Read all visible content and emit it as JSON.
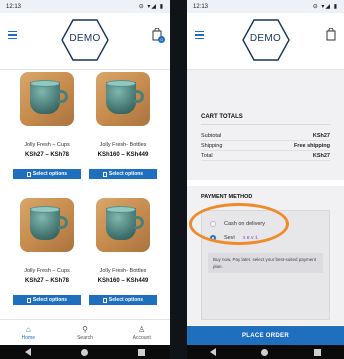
{
  "left_screen": {
    "status": {
      "time": "12:13",
      "icons": "⊝ ▾◢ ▮"
    },
    "logo": "DEMO",
    "cart_badge": "0",
    "products": [
      {
        "name": "Jolly Fresh – Cups",
        "price": "KSh27 – KSh78",
        "button": "Select options"
      },
      {
        "name": "Jolly Fresh- Bottles",
        "price": "KSh160 – KSh449",
        "button": "Select options"
      },
      {
        "name": "Jolly Fresh – Cups",
        "price": "KSh27 – KSh78",
        "button": "Select options"
      },
      {
        "name": "Jolly Fresh- Bottles",
        "price": "KSh160 – KSh449",
        "button": "Select options"
      }
    ],
    "bottom_nav": [
      {
        "label": "Home",
        "icon": "home-icon",
        "active": true
      },
      {
        "label": "Search",
        "icon": "search-icon",
        "active": false
      },
      {
        "label": "Account",
        "icon": "account-icon",
        "active": false
      }
    ]
  },
  "right_screen": {
    "status": {
      "time": "12:13",
      "icons": "⊝ ▾◢ ▮"
    },
    "logo": "DEMO",
    "cart_totals": {
      "title": "CART TOTALS",
      "rows": [
        {
          "label": "Subtotal",
          "value": "KSh27"
        },
        {
          "label": "Shipping",
          "value": "Free shipping"
        },
        {
          "label": "Total",
          "value": "KSh27"
        }
      ]
    },
    "payment": {
      "title": "PAYMENT METHOD",
      "options": [
        {
          "label": "Cash on delivery",
          "selected": false
        },
        {
          "label": "Sevi",
          "logo": "sevi",
          "selected": true
        }
      ],
      "note": "Buy now, Pay later. select your best-suited payment plan."
    },
    "place_order": "PLACE ORDER"
  },
  "colors": {
    "accent": "#1f6fbf",
    "highlight_circle": "#f08a2a",
    "logo_text": "#17325c"
  }
}
